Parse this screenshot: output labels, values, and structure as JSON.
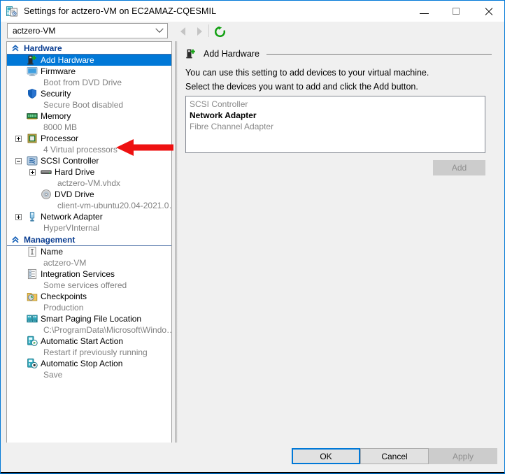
{
  "window": {
    "title": "Settings for actzero-VM on EC2AMAZ-CQESMIL",
    "icon": "settings-vm-icon",
    "minimize_label": "Minimize",
    "maximize_label": "Maximize",
    "close_label": "Close",
    "accent_color": "#0078d7"
  },
  "toolbar": {
    "vm_selector_value": "actzero-VM",
    "vm_selector_icon": "chevron-down-icon",
    "back_label": "Back",
    "forward_label": "Forward",
    "refresh_label": "Refresh",
    "refresh_color": "#12a012"
  },
  "tree": {
    "sections": [
      {
        "label": "Hardware",
        "collapse_icon": "double-chevron-up-icon",
        "items": [
          {
            "label": "Add Hardware",
            "sub": "",
            "icon": "add-hardware-icon",
            "selected": true,
            "expander": "none",
            "indent": 0
          },
          {
            "label": "Firmware",
            "sub": "Boot from DVD Drive",
            "icon": "firmware-monitor-icon",
            "selected": false,
            "expander": "none",
            "indent": 0
          },
          {
            "label": "Security",
            "sub": "Secure Boot disabled",
            "icon": "security-shield-icon",
            "selected": false,
            "expander": "none",
            "indent": 0
          },
          {
            "label": "Memory",
            "sub": "8000 MB",
            "icon": "memory-ram-icon",
            "selected": false,
            "expander": "none",
            "indent": 0
          },
          {
            "label": "Processor",
            "sub": "4 Virtual processors",
            "icon": "processor-chip-icon",
            "selected": false,
            "expander": "plus",
            "indent": 0
          },
          {
            "label": "SCSI Controller",
            "sub": "",
            "icon": "scsi-controller-icon",
            "selected": false,
            "expander": "minus",
            "indent": 0
          },
          {
            "label": "Hard Drive",
            "sub": "actzero-VM.vhdx",
            "icon": "hard-drive-icon",
            "selected": false,
            "expander": "plus",
            "indent": 1
          },
          {
            "label": "DVD Drive",
            "sub": "client-vm-ubuntu20.04-2021.0…",
            "icon": "dvd-drive-icon",
            "selected": false,
            "expander": "none",
            "indent": 1
          },
          {
            "label": "Network Adapter",
            "sub": "HyperVInternal",
            "icon": "network-adapter-icon",
            "selected": false,
            "expander": "plus",
            "indent": 0
          }
        ]
      },
      {
        "label": "Management",
        "collapse_icon": "double-chevron-up-icon",
        "items": [
          {
            "label": "Name",
            "sub": "actzero-VM",
            "icon": "name-tag-icon",
            "selected": false,
            "expander": "none",
            "indent": 0
          },
          {
            "label": "Integration Services",
            "sub": "Some services offered",
            "icon": "integration-services-icon",
            "selected": false,
            "expander": "none",
            "indent": 0
          },
          {
            "label": "Checkpoints",
            "sub": "Production",
            "icon": "checkpoints-icon",
            "selected": false,
            "expander": "none",
            "indent": 0
          },
          {
            "label": "Smart Paging File Location",
            "sub": "C:\\ProgramData\\Microsoft\\Windo…",
            "icon": "smart-paging-icon",
            "selected": false,
            "expander": "none",
            "indent": 0
          },
          {
            "label": "Automatic Start Action",
            "sub": "Restart if previously running",
            "icon": "auto-start-icon",
            "selected": false,
            "expander": "none",
            "indent": 0
          },
          {
            "label": "Automatic Stop Action",
            "sub": "Save",
            "icon": "auto-stop-icon",
            "selected": false,
            "expander": "none",
            "indent": 0
          }
        ]
      }
    ]
  },
  "detail": {
    "header_title": "Add Hardware",
    "header_icon": "add-hardware-icon",
    "paragraph_1": "You can use this setting to add devices to your virtual machine.",
    "paragraph_2": "Select the devices you want to add and click the Add button.",
    "device_list": [
      {
        "label": "SCSI Controller",
        "emphasis": false
      },
      {
        "label": "Network Adapter",
        "emphasis": true
      },
      {
        "label": "Fibre Channel Adapter",
        "emphasis": false
      }
    ],
    "add_button_label": "Add",
    "add_button_enabled": false
  },
  "annotation": {
    "arrow_color": "#ee1111",
    "arrow_direction": "left",
    "points_at": "Security"
  },
  "footer": {
    "ok_label": "OK",
    "cancel_label": "Cancel",
    "apply_label": "Apply"
  }
}
